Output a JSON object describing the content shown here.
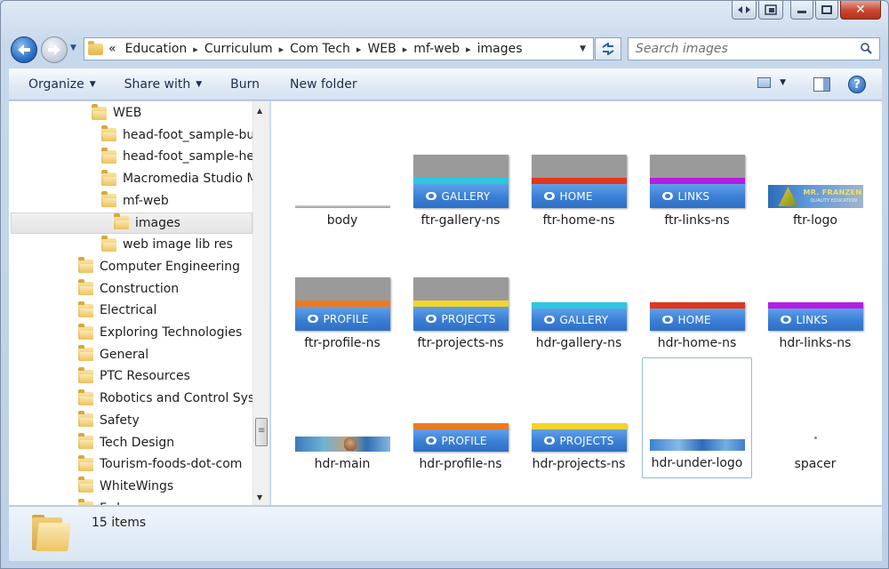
{
  "window": {
    "caption_buttons": [
      "back-forward-icon",
      "restore-icon",
      "minimize-icon",
      "maximize-icon",
      "close-icon"
    ],
    "close_glyph": "✕"
  },
  "address": {
    "chevron": "«",
    "crumbs": [
      "Education",
      "Curriculum",
      "Com Tech",
      "WEB",
      "mf-web",
      "images"
    ],
    "separator": "▸"
  },
  "search": {
    "placeholder": "Search images"
  },
  "toolbar": {
    "organize": "Organize",
    "share_with": "Share with",
    "burn": "Burn",
    "new_folder": "New folder",
    "help": "?"
  },
  "nav_tree": [
    {
      "label": "WEB",
      "indent": 1
    },
    {
      "label": "head-foot_sample-butt",
      "indent": 2
    },
    {
      "label": "head-foot_sample-hea",
      "indent": 2
    },
    {
      "label": "Macromedia Studio MX",
      "indent": 2
    },
    {
      "label": "mf-web",
      "indent": 2
    },
    {
      "label": "images",
      "indent": 3,
      "selected": true
    },
    {
      "label": "web image lib res",
      "indent": 2
    },
    {
      "label": "Computer Engineering",
      "indent": 0
    },
    {
      "label": "Construction",
      "indent": 0
    },
    {
      "label": "Electrical",
      "indent": 0
    },
    {
      "label": "Exploring Technologies",
      "indent": 0
    },
    {
      "label": "General",
      "indent": 0
    },
    {
      "label": "PTC Resources",
      "indent": 0
    },
    {
      "label": "Robotics and Control Syste",
      "indent": 0
    },
    {
      "label": "Safety",
      "indent": 0
    },
    {
      "label": "Tech Design",
      "indent": 0
    },
    {
      "label": "Tourism-foods-dot-com",
      "indent": 0
    },
    {
      "label": "WhiteWings",
      "indent": 0
    },
    {
      "label": "F...l",
      "indent": 0
    }
  ],
  "files": [
    {
      "name": "body",
      "kind": "line"
    },
    {
      "name": "ftr-gallery-ns",
      "kind": "ftr",
      "text": "GALLERY",
      "stripe": "#2fc6e0"
    },
    {
      "name": "ftr-home-ns",
      "kind": "ftr",
      "text": "HOME",
      "stripe": "#e2361d"
    },
    {
      "name": "ftr-links-ns",
      "kind": "ftr",
      "text": "LINKS",
      "stripe": "#b51ee0"
    },
    {
      "name": "ftr-logo",
      "kind": "logo",
      "text": "MR. FRANZEN",
      "sub": "QUALITY EDUCATION"
    },
    {
      "name": "ftr-profile-ns",
      "kind": "ftr",
      "text": "PROFILE",
      "stripe": "#ee7a1f"
    },
    {
      "name": "ftr-projects-ns",
      "kind": "ftr",
      "text": "PROJECTS",
      "stripe": "#f2d62a"
    },
    {
      "name": "hdr-gallery-ns",
      "kind": "hdr",
      "text": "GALLERY",
      "stripe": "#2fc6e0"
    },
    {
      "name": "hdr-home-ns",
      "kind": "hdr",
      "text": "HOME",
      "stripe": "#e2361d"
    },
    {
      "name": "hdr-links-ns",
      "kind": "hdr",
      "text": "LINKS",
      "stripe": "#b51ee0"
    },
    {
      "name": "hdr-main",
      "kind": "main"
    },
    {
      "name": "hdr-profile-ns",
      "kind": "hdr",
      "text": "PROFILE",
      "stripe": "#ee7a1f"
    },
    {
      "name": "hdr-projects-ns",
      "kind": "hdr",
      "text": "PROJECTS",
      "stripe": "#f2d62a"
    },
    {
      "name": "hdr-under-logo",
      "kind": "underlogo",
      "selected": true
    },
    {
      "name": "spacer",
      "kind": "spacer"
    }
  ],
  "status": {
    "item_count": "15 items"
  }
}
